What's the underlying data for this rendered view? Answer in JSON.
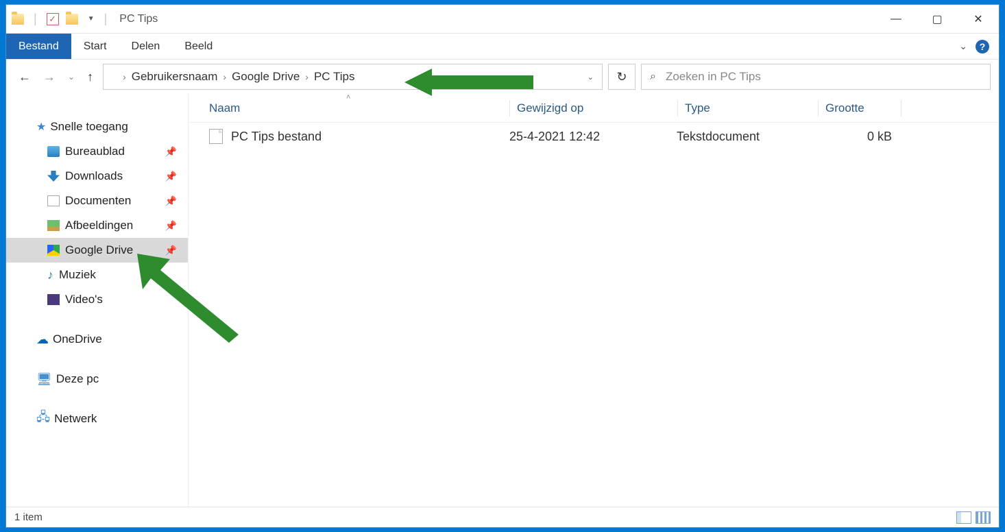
{
  "window": {
    "title": "PC Tips"
  },
  "menubar": {
    "tabs": [
      "Bestand",
      "Start",
      "Delen",
      "Beeld"
    ]
  },
  "breadcrumb": {
    "parts": [
      "Gebruikersnaam",
      "Google Drive",
      "PC Tips"
    ]
  },
  "search": {
    "placeholder": "Zoeken in PC Tips"
  },
  "sidebar": {
    "quick_access": "Snelle toegang",
    "items": [
      {
        "label": "Bureaublad",
        "pinned": true
      },
      {
        "label": "Downloads",
        "pinned": true
      },
      {
        "label": "Documenten",
        "pinned": true
      },
      {
        "label": "Afbeeldingen",
        "pinned": true
      },
      {
        "label": "Google Drive",
        "pinned": true,
        "selected": true
      },
      {
        "label": "Muziek",
        "pinned": false
      },
      {
        "label": "Video's",
        "pinned": false
      }
    ],
    "onedrive": "OneDrive",
    "this_pc": "Deze pc",
    "network": "Netwerk"
  },
  "columns": {
    "name": "Naam",
    "modified": "Gewijzigd op",
    "type": "Type",
    "size": "Grootte"
  },
  "files": [
    {
      "name": "PC Tips bestand",
      "modified": "25-4-2021 12:42",
      "type": "Tekstdocument",
      "size": "0 kB"
    }
  ],
  "status": {
    "count": "1 item"
  }
}
